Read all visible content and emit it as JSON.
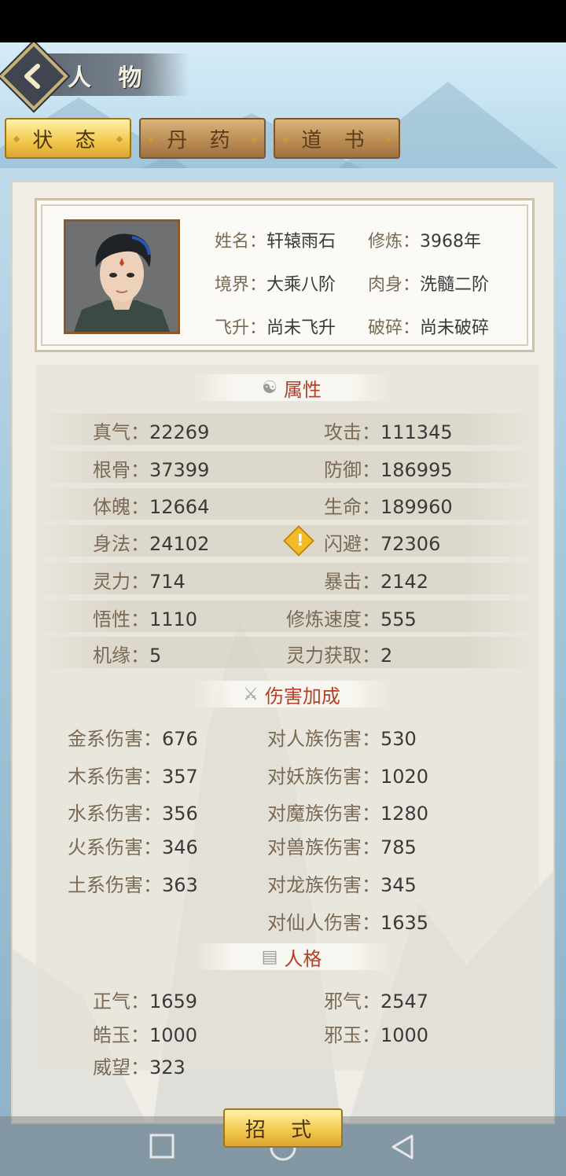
{
  "header": {
    "title": "人 物"
  },
  "tabs": [
    {
      "label": "状 态"
    },
    {
      "label": "丹 药"
    },
    {
      "label": "道 书"
    }
  ],
  "profile": {
    "name": {
      "k": "姓名：",
      "v": "轩辕雨石"
    },
    "cultivation": {
      "k": "修炼：",
      "v": "3968年"
    },
    "realm": {
      "k": "境界：",
      "v": "大乘八阶"
    },
    "body": {
      "k": "肉身：",
      "v": "洗髓二阶"
    },
    "ascend": {
      "k": "飞升：",
      "v": "尚未飞升"
    },
    "shatter": {
      "k": "破碎：",
      "v": "尚未破碎"
    }
  },
  "attributes": {
    "title": "属性",
    "rows": [
      {
        "lk": "真气：",
        "lv": "22269",
        "rk": "攻击：",
        "rv": "111345"
      },
      {
        "lk": "根骨：",
        "lv": "37399",
        "rk": "防御：",
        "rv": "186995"
      },
      {
        "lk": "体魄：",
        "lv": "12664",
        "rk": "生命：",
        "rv": "189960"
      },
      {
        "lk": "身法：",
        "lv": "24102",
        "rk": "闪避：",
        "rv": "72306"
      },
      {
        "lk": "灵力：",
        "lv": "714",
        "rk": "暴击：",
        "rv": "2142"
      },
      {
        "lk": "悟性：",
        "lv": "1110",
        "rk": "修炼速度：",
        "rv": "555"
      },
      {
        "lk": "机缘：",
        "lv": "5",
        "rk": "灵力获取：",
        "rv": "2"
      }
    ]
  },
  "damage": {
    "title": "伤害加成",
    "rows": [
      {
        "lk": "金系伤害：",
        "lv": "676",
        "rk": "对人族伤害：",
        "rv": "530"
      },
      {
        "lk": "木系伤害：",
        "lv": "357",
        "rk": "对妖族伤害：",
        "rv": "1020"
      },
      {
        "lk": "水系伤害：",
        "lv": "356",
        "rk": "对魔族伤害：",
        "rv": "1280"
      },
      {
        "lk": "火系伤害：",
        "lv": "346",
        "rk": "对兽族伤害：",
        "rv": "785"
      },
      {
        "lk": "土系伤害：",
        "lv": "363",
        "rk": "对龙族伤害：",
        "rv": "345"
      },
      {
        "lk": "",
        "lv": "",
        "rk": "对仙人伤害：",
        "rv": "1635"
      }
    ]
  },
  "personality": {
    "title": "人格",
    "rows": [
      {
        "lk": "正气：",
        "lv": "1659",
        "rk": "邪气：",
        "rv": "2547"
      },
      {
        "lk": "皓玉：",
        "lv": "1000",
        "rk": "邪玉：",
        "rv": "1000"
      },
      {
        "lk": "威望：",
        "lv": "323",
        "rk": "",
        "rv": ""
      }
    ]
  },
  "bottom": {
    "skill_label": "招 式"
  }
}
